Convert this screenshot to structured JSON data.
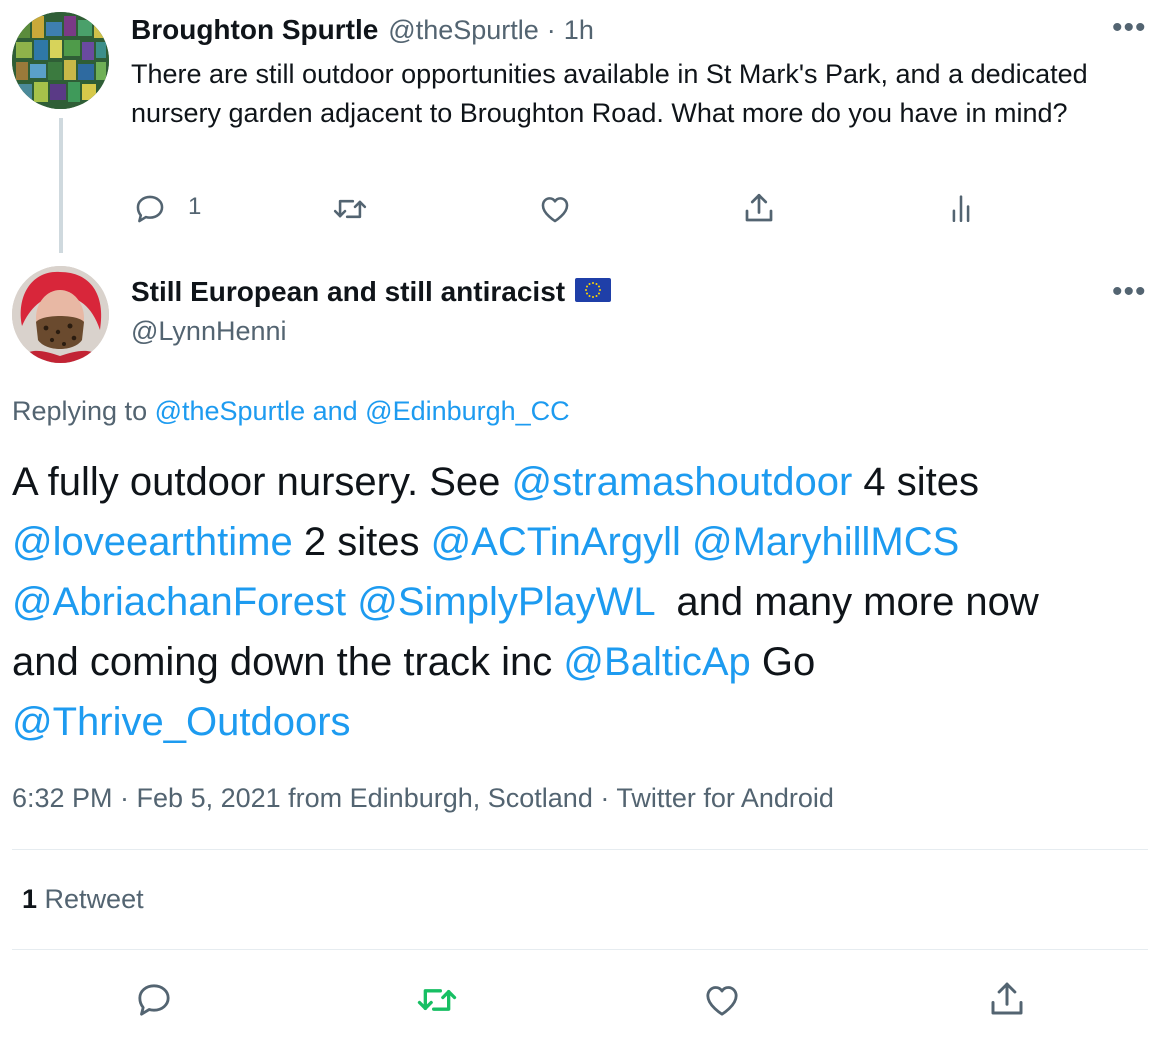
{
  "reply_tweet": {
    "name": "Broughton Spurtle",
    "handle": "@theSpurtle",
    "sep": "·",
    "time": "1h",
    "text": "There are still outdoor opportunities available in St Mark's Park, and a dedicated nursery garden adjacent to Broughton Road. What more do you have in mind?",
    "actions": {
      "reply_icon": "speech-bubble",
      "reply_count": "1",
      "retweet_icon": "retweet-arrows",
      "like_icon": "heart-outline",
      "share_icon": "share-upload",
      "analytics_icon": "bar-chart"
    },
    "more_icon": "ellipsis"
  },
  "main_tweet": {
    "name": "Still European and still antiracist",
    "flag_icon": "eu-flag",
    "handle": "@LynnHenni",
    "replying_prefix": "Replying to ",
    "replying_user1": "@theSpurtle",
    "replying_and": " and ",
    "replying_user2": "@Edinburgh_CC",
    "text_parts": {
      "p1": "A fully outdoor nursery. See ",
      "m1": "@stramashoutdoor",
      "p2": " 4 sites",
      "m2": "@loveearthtime",
      "p3": " 2 sites ",
      "m3": "@ACTinArgyll",
      "p4": " ",
      "m4": "@MaryhillMCS",
      "m5": "@AbriachanForest",
      "p5": " ",
      "m6": "@SimplyPlayWL",
      "p6": "  and many more now",
      "p7": "and coming down the track inc ",
      "m7": "@BalticAp",
      "p8": " Go",
      "m8": "@Thrive_Outdoors"
    },
    "timestamp": "6:32 PM · Feb 5, 2021 from Edinburgh, Scotland · Twitter for Android",
    "stats": {
      "retweet_count": "1",
      "retweet_label": "Retweet"
    },
    "actions": {
      "reply_icon": "speech-bubble",
      "retweet_icon": "retweet-arrows",
      "like_icon": "heart-outline",
      "share_icon": "share-upload"
    },
    "more_icon": "ellipsis"
  },
  "colors": {
    "link": "#1d9bf0",
    "muted": "#536471",
    "retweet_active": "#17bf63",
    "divider": "#e6ecf0"
  }
}
